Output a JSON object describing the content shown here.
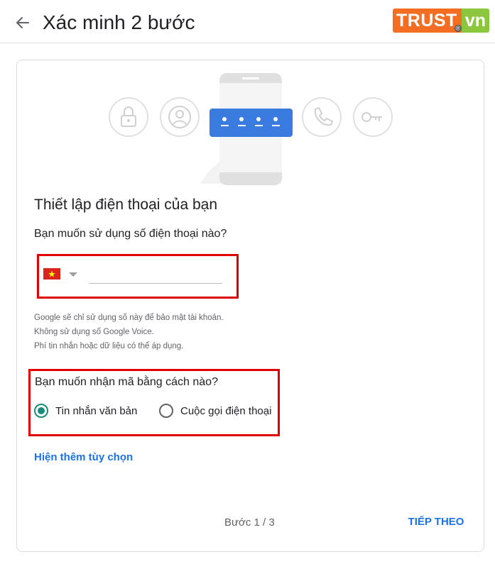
{
  "header": {
    "back_icon": "arrow-left-icon",
    "title": "Xác minh 2 bước",
    "logo": {
      "main": "TRUST",
      "suffix": "vn",
      "mark": "®",
      "main_color": "#f36e22",
      "suffix_color": "#8cc63e"
    }
  },
  "illustration": {
    "icons": [
      "lock-icon",
      "user-icon",
      "phone-device-icon",
      "call-icon",
      "key-icon"
    ],
    "accent_color": "#4285f4"
  },
  "form": {
    "title": "Thiết lập điện thoại của bạn",
    "phone_question": "Bạn muốn sử dụng số điện thoại nào?",
    "country_flag": "vietnam-flag-icon",
    "phone_value": "",
    "info_lines": [
      "Google sẽ chỉ sử dụng số này để bảo mật tài khoản.",
      "Không sử dụng số Google Voice.",
      "Phí tin nhắn hoặc dữ liệu có thể áp dụng."
    ],
    "method_question": "Bạn muốn nhận mã bằng cách nào?",
    "options": [
      {
        "label": "Tin nhắn văn bản",
        "checked": true
      },
      {
        "label": "Cuộc gọi điện thoại",
        "checked": false
      }
    ],
    "more_options": "Hiện thêm tùy chọn"
  },
  "footer": {
    "step": "Bước 1 / 3",
    "next": "TIẾP THEO"
  },
  "colors": {
    "highlight_border": "#e00000",
    "link": "#1a73e8",
    "radio_selected": "#1a8a7a"
  }
}
